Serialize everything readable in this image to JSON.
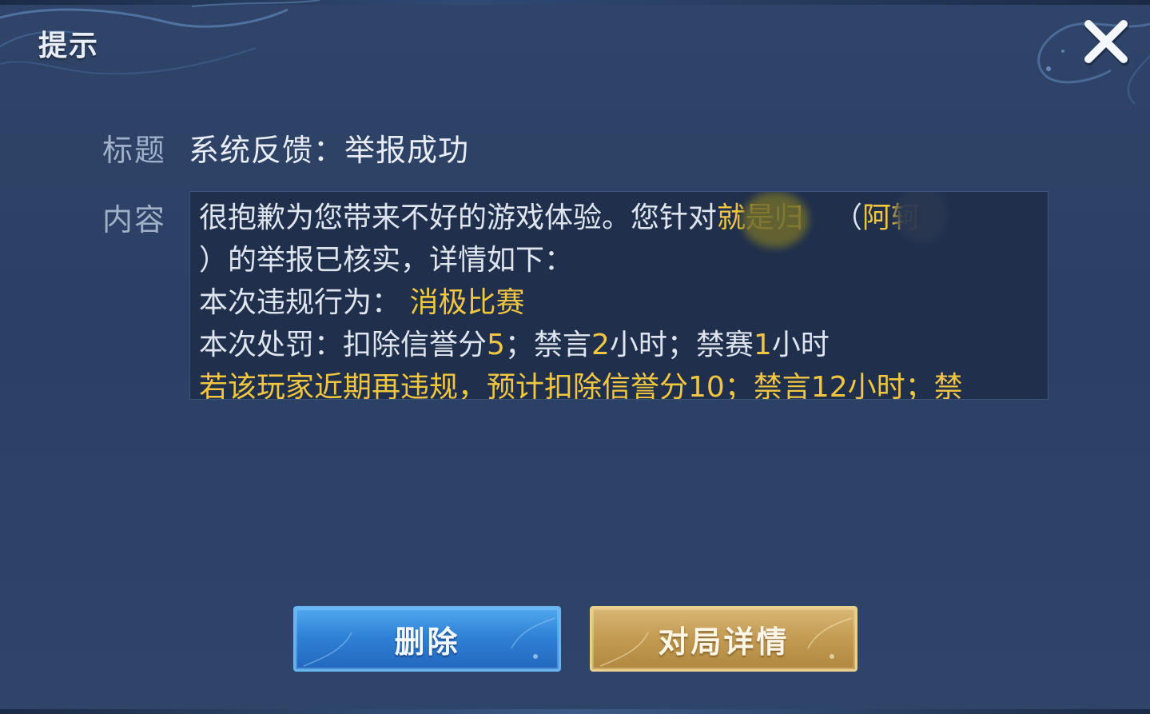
{
  "dialog": {
    "title": "提示",
    "close_icon": "close-x-icon"
  },
  "subject": {
    "label": "标题",
    "value": "系统反馈：举报成功"
  },
  "content": {
    "label": "内容",
    "line1_text": "很抱歉为您带来不好的游戏体验。您针对",
    "line1_name": "就是归",
    "line1_paren_open": "（",
    "line1_hero": "阿轲",
    "line2_text": "）的举报已核实，详情如下：",
    "line3_label": "本次违规行为：",
    "line3_value": "消极比赛",
    "line4_a": "本次处罚：扣除信誉分",
    "line4_b": "5",
    "line4_c": "；禁言",
    "line4_d": "2",
    "line4_e": "小时；禁赛",
    "line4_f": "1",
    "line4_g": "小时",
    "line5_text": "若该玩家近期再违规，预计扣除信誉分10；禁言12小时；禁"
  },
  "buttons": {
    "delete_label": "删除",
    "detail_label": "对局详情"
  },
  "colors": {
    "highlight": "#f1c640",
    "background": "#2c4065",
    "delete_button": "#2f82d6",
    "detail_button": "#c29a52"
  }
}
